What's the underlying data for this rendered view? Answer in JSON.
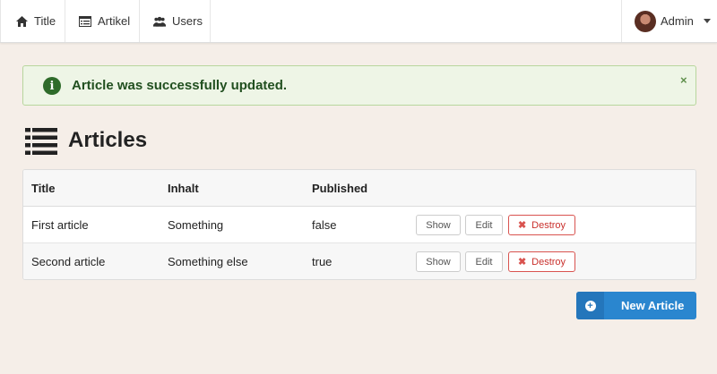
{
  "nav": {
    "items": [
      {
        "label": "Title",
        "icon": "home-icon"
      },
      {
        "label": "Artikel",
        "icon": "list-alt-icon"
      },
      {
        "label": "Users",
        "icon": "users-icon"
      }
    ],
    "user": {
      "name": "Admin",
      "icon": "avatar"
    }
  },
  "alert": {
    "message": "Article was successfully updated.",
    "close_label": "×",
    "color": "#eef5e6"
  },
  "page": {
    "title": "Articles",
    "icon": "list-icon"
  },
  "table": {
    "headers": [
      "Title",
      "Inhalt",
      "Published"
    ],
    "rows": [
      {
        "title": "First article",
        "inhalt": "Something",
        "published": "false",
        "show": "Show",
        "edit": "Edit",
        "destroy": "Destroy"
      },
      {
        "title": "Second article",
        "inhalt": "Something else",
        "published": "true",
        "show": "Show",
        "edit": "Edit",
        "destroy": "Destroy"
      }
    ]
  },
  "actions": {
    "new_label": "New Article",
    "accent": "#2a86cf"
  }
}
